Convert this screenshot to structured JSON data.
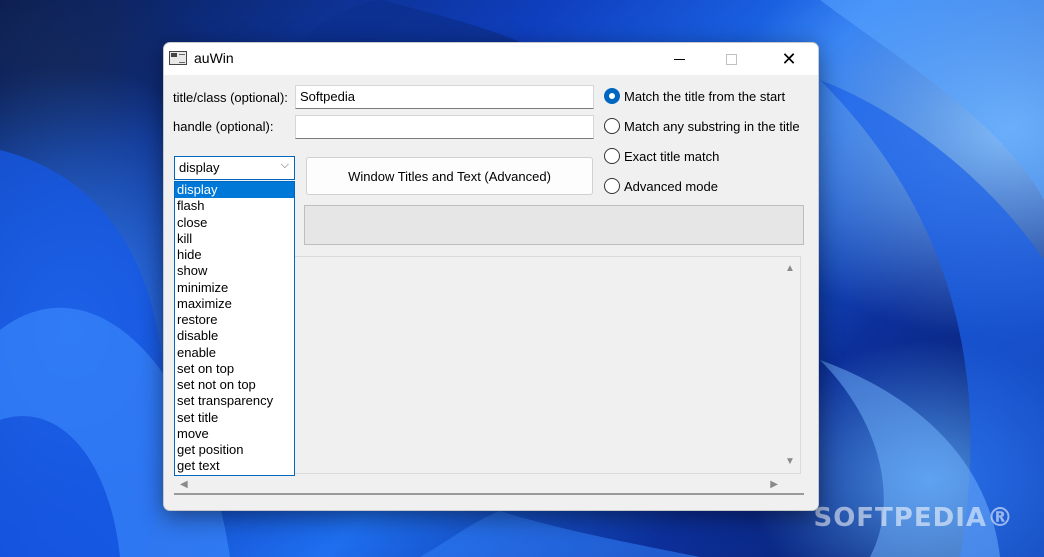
{
  "watermark": "SOFTPEDIA®",
  "window": {
    "title": "auWin",
    "icons": {
      "app": "window-icon",
      "minimize": "minimize-icon",
      "maximize": "maximize-icon",
      "close": "close-icon"
    }
  },
  "form": {
    "title_class_label": "title/class (optional):",
    "title_class_value": "Softpedia",
    "handle_label": "handle (optional):",
    "handle_value": "",
    "advanced_button_label": "Window Titles and Text (Advanced)",
    "status_value": ""
  },
  "match_options": [
    {
      "label": "Match the title from the start",
      "selected": true
    },
    {
      "label": "Match any substring in the title",
      "selected": false
    },
    {
      "label": "Exact title match",
      "selected": false
    },
    {
      "label": "Advanced mode",
      "selected": false
    }
  ],
  "action_combo": {
    "selected": "display",
    "options": [
      "display",
      "flash",
      "close",
      "kill",
      "hide",
      "show",
      "minimize",
      "maximize",
      "restore",
      "disable",
      "enable",
      "set on top",
      "set not on top",
      "set transparency",
      "set title",
      "move",
      "get position",
      "get text"
    ]
  },
  "colors": {
    "accent": "#0067c0",
    "selection": "#0078d7",
    "window_bg": "#f0f0f0"
  }
}
